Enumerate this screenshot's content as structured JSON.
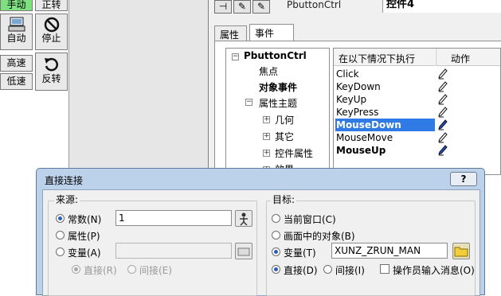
{
  "left_controls": {
    "manual": "手动",
    "forward": "正转",
    "auto": "自动",
    "stop": "停止",
    "high_speed": "高速",
    "low_speed": "低速",
    "reverse": "反转",
    "manual_color": "#7fe07f"
  },
  "property_panel": {
    "control_name_label": "PbuttonCtrl",
    "control_title": "控件4",
    "tabs": [
      "属性",
      "事件"
    ],
    "active_tab": "事件",
    "tree": {
      "root": "PbuttonCtrl",
      "items": [
        "焦点",
        "对象事件",
        "属性主题",
        "几何",
        "其它",
        "控件属性",
        "效果"
      ]
    },
    "events": {
      "header_condition": "在以下情况下执行",
      "header_action": "动作",
      "rows": [
        "Click",
        "KeyDown",
        "KeyUp",
        "KeyPress",
        "MouseDown",
        "MouseMove",
        "MouseUp"
      ],
      "selected": "MouseDown",
      "bold": [
        "MouseUp"
      ],
      "selection_color": "#2f7ae5"
    }
  },
  "dialog": {
    "title": "直接连接",
    "help": "?",
    "close": "x",
    "source": {
      "group_label": "来源:",
      "constant": "常数(N)",
      "constant_value": "1",
      "property": "属性(P)",
      "variable": "变量(A)",
      "direct": "直接(R)",
      "indirect": "间接(E)"
    },
    "target": {
      "group_label": "目标:",
      "current_window": "当前窗口(C)",
      "object_in_picture": "画面中的对象(B)",
      "variable": "变量(T)",
      "variable_value": "XUNZ_ZRUN_MAN",
      "direct": "直接(D)",
      "indirect": "间接(I)",
      "operator_input": "操作员输入消息(O)"
    },
    "title_color": "#bcd2ea"
  }
}
